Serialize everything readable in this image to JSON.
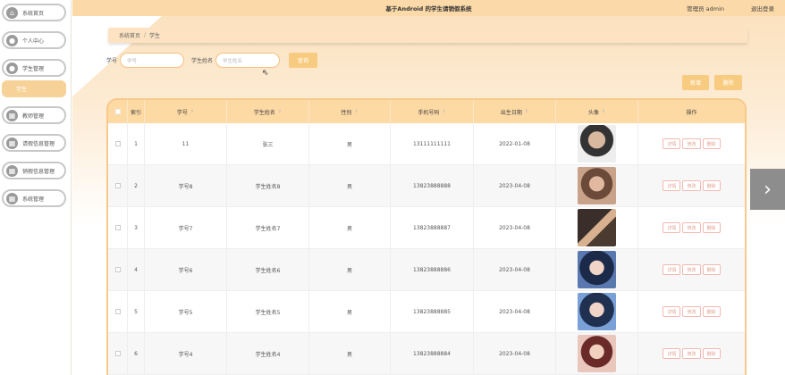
{
  "header": {
    "title": "基于Android 的学生请销假系统",
    "admin_label": "管理员 admin",
    "logout": "退出登录"
  },
  "sidebar": {
    "items": [
      {
        "label": "系统首页",
        "icon": "home-icon"
      },
      {
        "label": "个人中心",
        "icon": "user-icon"
      },
      {
        "label": "学生管理",
        "icon": "user-icon"
      },
      {
        "label": "教师管理",
        "icon": "grid-icon"
      },
      {
        "label": "请假信息管理",
        "icon": "grid-icon"
      },
      {
        "label": "销假信息管理",
        "icon": "grid-icon"
      },
      {
        "label": "系统管理",
        "icon": "grid-icon"
      }
    ],
    "sub_item": "学生"
  },
  "breadcrumb": {
    "home": "系统首页",
    "separator": "/",
    "current": "学生"
  },
  "search": {
    "field1_label": "学号",
    "field1_placeholder": "学号",
    "field2_label": "学生姓名",
    "field2_placeholder": "学生姓名",
    "button": "查询"
  },
  "actions": {
    "add": "新增",
    "delete": "删除"
  },
  "table": {
    "headers": [
      "",
      "索引",
      "学号",
      "学生姓名",
      "性别",
      "手机号码",
      "出生日期",
      "头像",
      "操作"
    ],
    "op_labels": {
      "detail": "详情",
      "edit": "修改",
      "delete": "删除"
    },
    "rows": [
      {
        "index": "1",
        "id": "11",
        "name": "张三",
        "gender": "男",
        "phone": "13111111111",
        "birth": "2022-01-08"
      },
      {
        "index": "2",
        "id": "学号8",
        "name": "学生姓名8",
        "gender": "男",
        "phone": "13823888888",
        "birth": "2023-04-08"
      },
      {
        "index": "3",
        "id": "学号7",
        "name": "学生姓名7",
        "gender": "男",
        "phone": "13823888887",
        "birth": "2023-04-08"
      },
      {
        "index": "4",
        "id": "学号6",
        "name": "学生姓名6",
        "gender": "男",
        "phone": "13823888886",
        "birth": "2023-04-08"
      },
      {
        "index": "5",
        "id": "学号5",
        "name": "学生姓名5",
        "gender": "男",
        "phone": "13823888885",
        "birth": "2023-04-08"
      },
      {
        "index": "6",
        "id": "学号4",
        "name": "学生姓名4",
        "gender": "男",
        "phone": "13823888884",
        "birth": "2023-04-08"
      }
    ]
  },
  "colors": {
    "accent": "#f7cc80",
    "topbar": "#fcd9a8",
    "table_header": "#fdd9a4"
  }
}
